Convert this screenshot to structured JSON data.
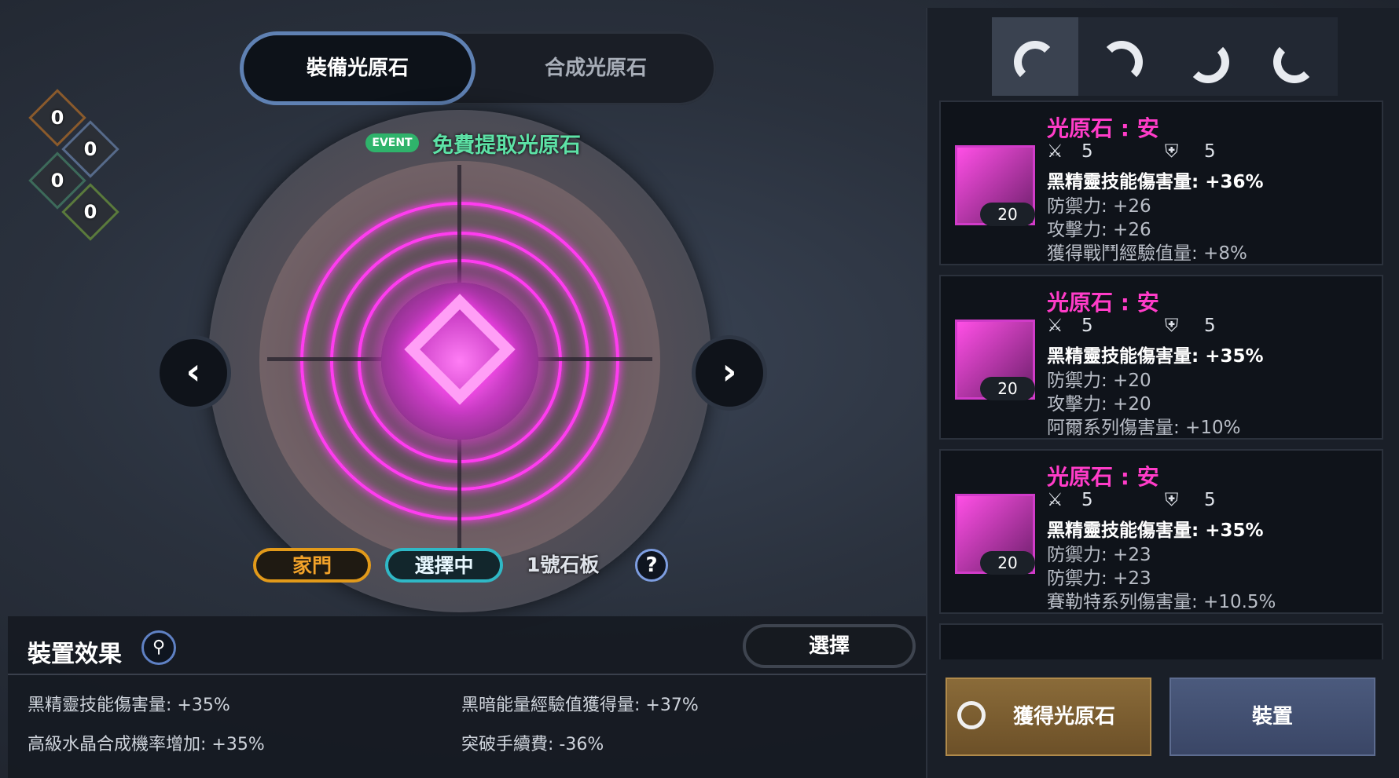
{
  "tabs": {
    "equip": "裝備光原石",
    "synth": "合成光原石"
  },
  "counters": [
    "0",
    "0",
    "0",
    "0"
  ],
  "event": {
    "badge": "EVENT",
    "text": "免費提取光原石"
  },
  "nav": {
    "prev": "‹",
    "next": "›"
  },
  "chips": {
    "home": "家門",
    "selected": "選擇中",
    "slab": "1號石板",
    "help": "?"
  },
  "effects": {
    "title": "裝置效果",
    "choose": "選擇",
    "items": [
      "黑精靈技能傷害量: +35%",
      "黑暗能量經驗值獲得量: +37%",
      "高級水晶合成機率增加: +35%",
      "突破手續費: -36%"
    ]
  },
  "cards": [
    {
      "name": "光原石 : 安",
      "level": "20",
      "atk": "5",
      "def": "5",
      "main": "黑精靈技能傷害量: +36%",
      "lines": [
        "防禦力: +26",
        "攻擊力: +26",
        "獲得戰鬥經驗值量: +8%"
      ]
    },
    {
      "name": "光原石 : 安",
      "level": "20",
      "atk": "5",
      "def": "5",
      "main": "黑精靈技能傷害量: +35%",
      "lines": [
        "防禦力: +20",
        "攻擊力: +20",
        "阿爾系列傷害量: +10%"
      ]
    },
    {
      "name": "光原石 : 安",
      "level": "20",
      "atk": "5",
      "def": "5",
      "main": "黑精靈技能傷害量: +35%",
      "lines": [
        "防禦力: +23",
        "防禦力: +23",
        "賽勒特系列傷害量: +10.5%"
      ]
    }
  ],
  "buttons": {
    "get": "獲得光原石",
    "equip": "裝置"
  },
  "colors": {
    "accent": "#ff3cc8",
    "event": "#2fb36b",
    "home": "#e29a1a",
    "selected": "#2fb8c6"
  }
}
